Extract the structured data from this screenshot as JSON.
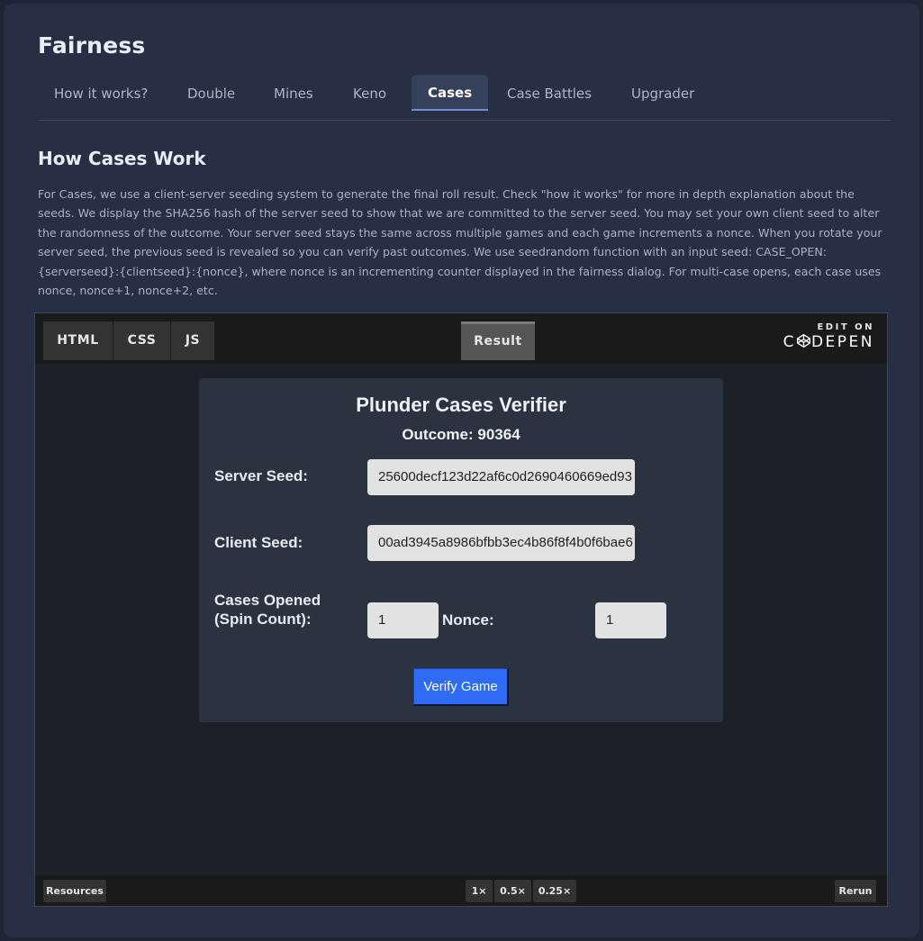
{
  "page": {
    "title": "Fairness"
  },
  "tabs": [
    {
      "label": "How it works?"
    },
    {
      "label": "Double"
    },
    {
      "label": "Mines"
    },
    {
      "label": "Keno"
    },
    {
      "label": "Cases"
    },
    {
      "label": "Case Battles"
    },
    {
      "label": "Upgrader"
    }
  ],
  "active_tab": "Cases",
  "section": {
    "title": "How Cases Work",
    "description": "For Cases, we use a client-server seeding system to generate the final roll result. Check \"how it works\" for more in depth explanation about the seeds. We display the SHA256 hash of the server seed to show that we are committed to the server seed. You may set your own client seed to alter the randomness of the outcome. Your server seed stays the same across multiple games and each game increments a nonce. When you rotate your server seed, the previous seed is revealed so you can verify past outcomes. We use seedrandom function with an input seed: CASE_OPEN:{serverseed}:{clientseed}:{nonce}, where nonce is an incrementing counter displayed in the fairness dialog. For multi-case opens, each case uses nonce, nonce+1, nonce+2, etc."
  },
  "codepen": {
    "tabs": {
      "html": "HTML",
      "css": "CSS",
      "js": "JS",
      "result": "Result"
    },
    "edit_on": "EDIT ON",
    "logo_left": "C",
    "logo_right": "DEPEN",
    "footer": {
      "resources": "Resources",
      "zoom_1": "1×",
      "zoom_05": "0.5×",
      "zoom_025": "0.25×",
      "rerun": "Rerun"
    }
  },
  "verifier": {
    "title": "Plunder Cases Verifier",
    "outcome": "Outcome: 90364",
    "server_seed_label": "Server Seed:",
    "server_seed_value": "25600decf123d22af6c0d2690460669ed93",
    "client_seed_label": "Client Seed:",
    "client_seed_value": "00ad3945a8986bfbb3ec4b86f8f4b0f6bae6",
    "cases_opened_label_1": "Cases Opened",
    "cases_opened_label_2": "(Spin Count):",
    "cases_opened_value": "1",
    "nonce_label": "Nonce:",
    "nonce_value": "1",
    "verify_button": "Verify Game"
  },
  "colors": {
    "background": "#1e2535",
    "panel": "#262f43",
    "accent": "#2e6cf6"
  }
}
